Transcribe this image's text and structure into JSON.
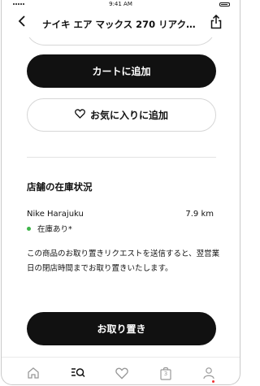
{
  "status_bar": {
    "time": "9:41 AM"
  },
  "header": {
    "title": "ナイキ エア マックス 270 リアクト...",
    "back_icon": "chevron-left-icon",
    "share_icon": "share-icon"
  },
  "actions": {
    "add_to_cart": "カートに追加",
    "add_to_favorites": "お気に入りに追加",
    "reserve": "お取り置き"
  },
  "store": {
    "section_title": "店舗の在庫状況",
    "name": "Nike Harajuku",
    "distance": "7.9 km",
    "stock_status": "在庫あり*",
    "stock_color": "#3fb54a",
    "description": "この商品のお取り置きリクエストを送信すると、翌営業日の閉店時間までお取り置きいたします。"
  },
  "tab_bar": {
    "items": [
      "home-icon",
      "search-icon",
      "heart-icon",
      "bag-icon",
      "profile-icon"
    ],
    "bag_count": "3",
    "active": "search-icon"
  }
}
